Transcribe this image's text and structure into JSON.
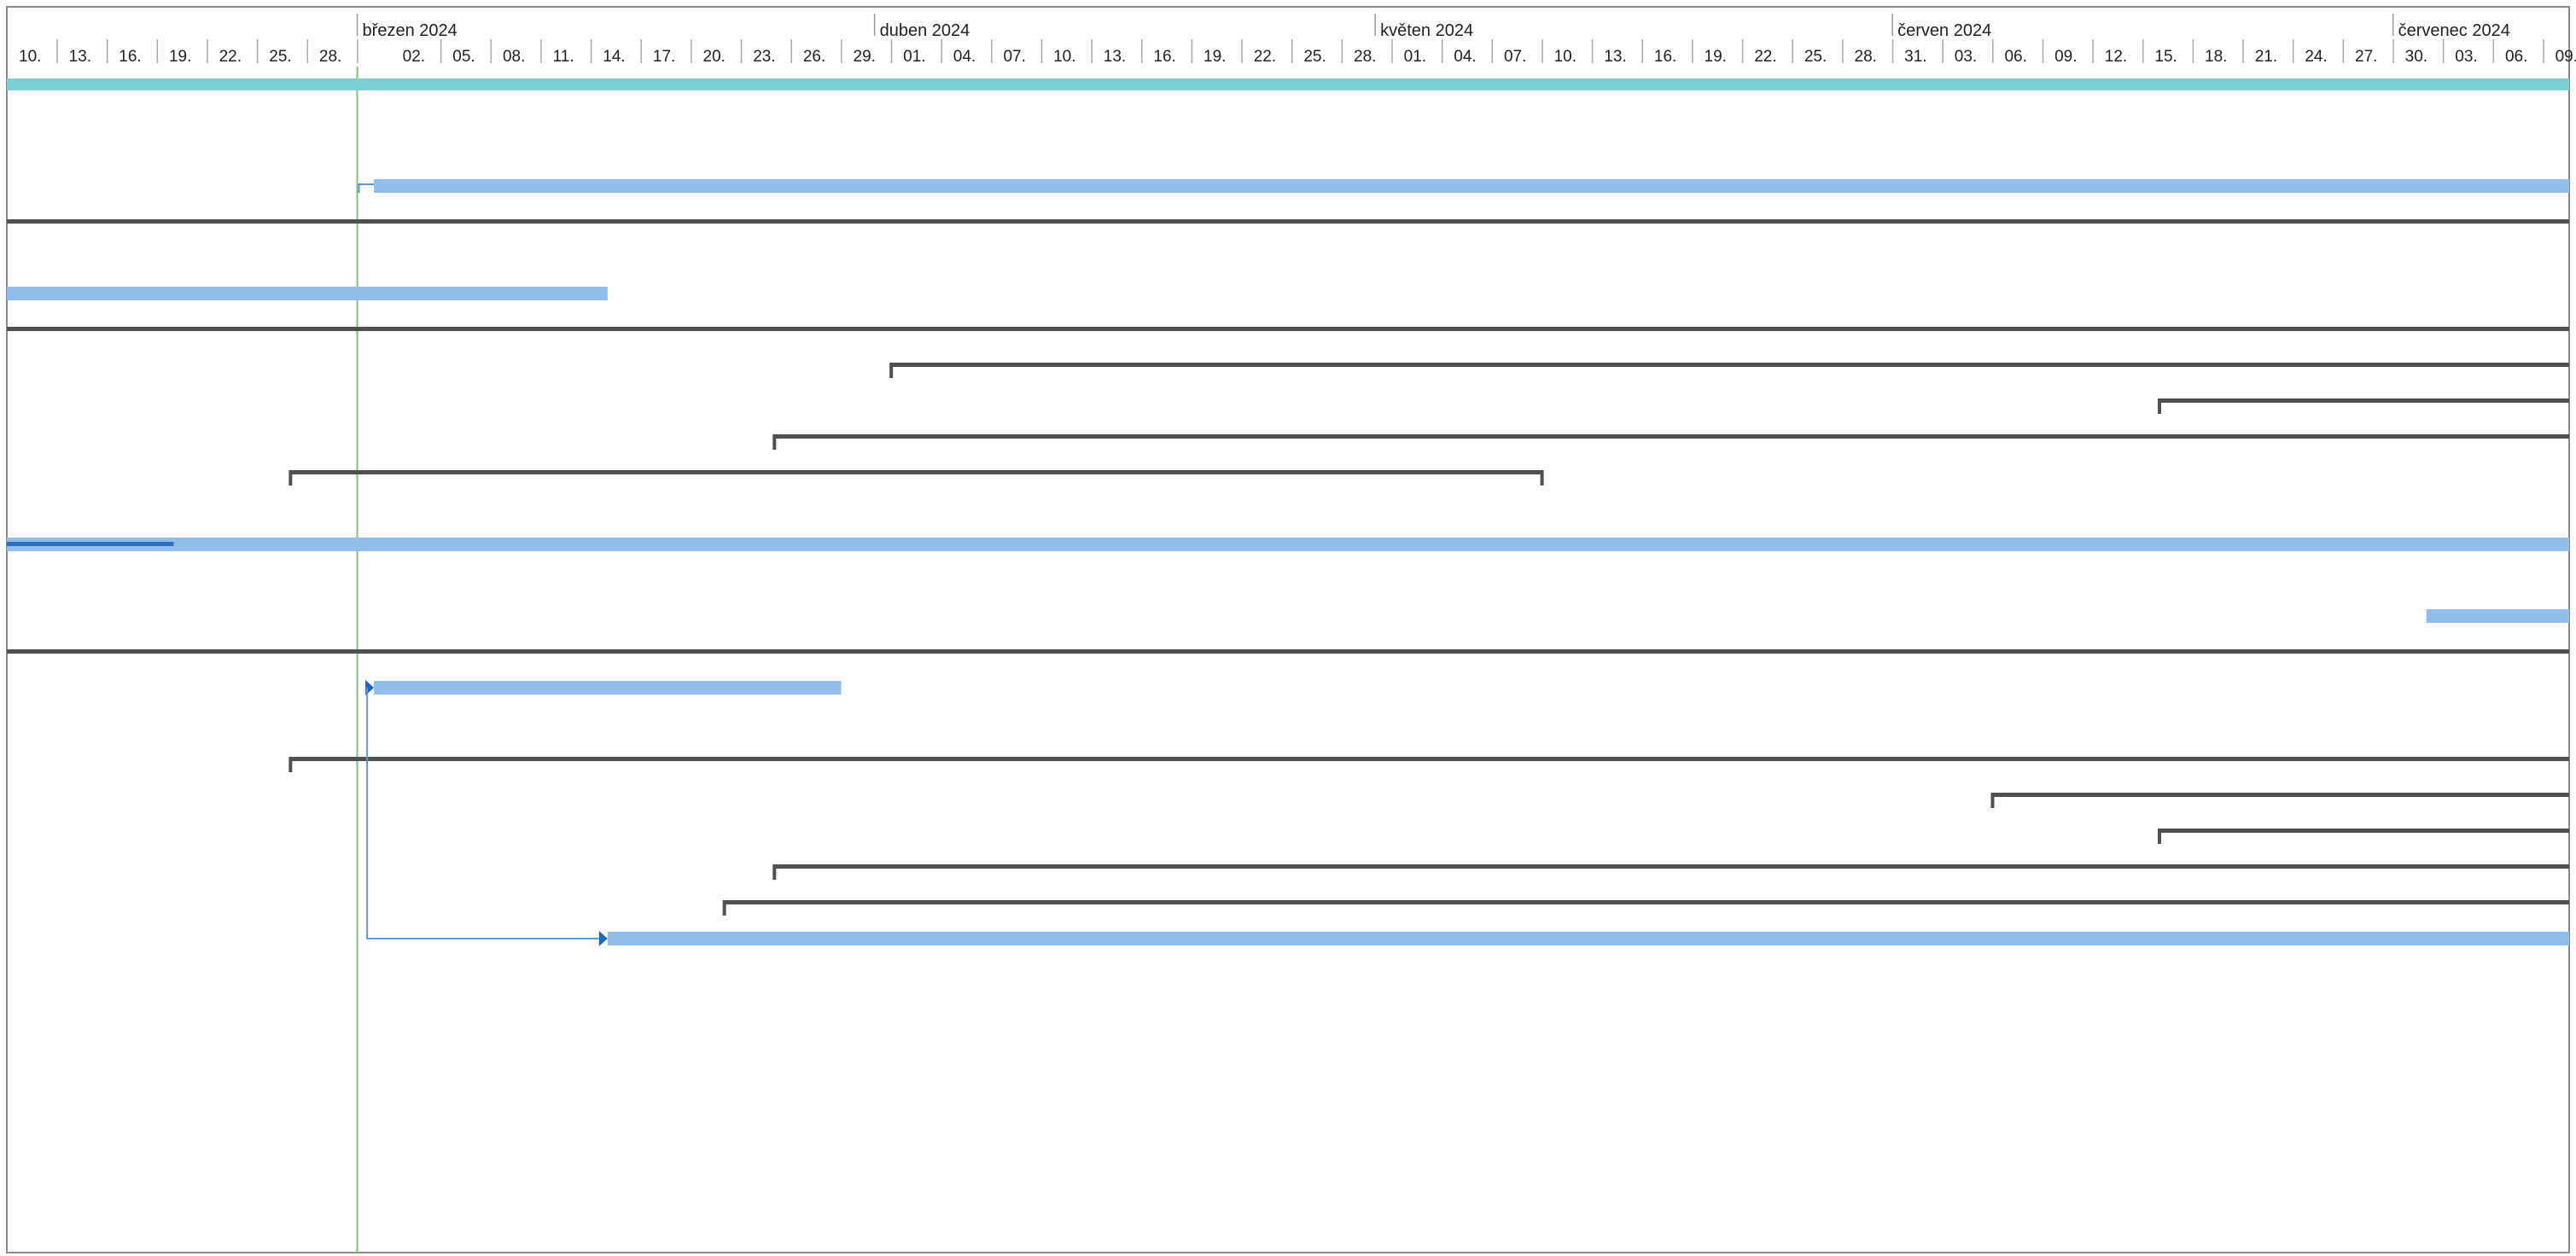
{
  "timescale": {
    "months": [
      "březen 2024",
      "duben 2024",
      "květen 2024",
      "červen 2024",
      "červenec 2024"
    ],
    "days": [
      "10.",
      "13.",
      "16.",
      "19.",
      "22.",
      "25.",
      "28.",
      "02.",
      "05.",
      "08.",
      "11.",
      "14.",
      "17.",
      "20.",
      "23.",
      "26.",
      "29.",
      "01.",
      "04.",
      "07.",
      "10.",
      "13.",
      "16.",
      "19.",
      "22.",
      "25.",
      "28.",
      "01.",
      "04.",
      "07.",
      "10.",
      "13.",
      "16.",
      "19.",
      "22.",
      "25.",
      "28.",
      "31.",
      "03.",
      "06.",
      "09.",
      "12.",
      "15.",
      "18.",
      "21.",
      "24.",
      "27.",
      "30.",
      "03.",
      "06.",
      "09."
    ]
  },
  "colors": {
    "summary_bar": "#7dcfd3",
    "task_bar": "#90bde9",
    "task_progress": "#2f6fbf",
    "range_line": "#505050",
    "today_line": "#7cc47c",
    "link": "#5a9ad6",
    "grid_text": "#222222",
    "border": "#8a8a8a"
  },
  "today_line": {
    "date": "2024-02-29"
  },
  "rows": [
    {
      "kind": "summary",
      "start": "2024-02-08",
      "end": "2024-07-13"
    },
    {
      "kind": "none"
    },
    {
      "kind": "none"
    },
    {
      "kind": "task",
      "start": "2024-03-01",
      "end": "2024-07-13",
      "has_predecessor_link": true
    },
    {
      "kind": "range_full",
      "start": "2024-02-08",
      "end": "2024-07-13"
    },
    {
      "kind": "none"
    },
    {
      "kind": "task",
      "start": "2024-02-08",
      "end": "2024-03-15"
    },
    {
      "kind": "range_full",
      "start": "2024-02-08",
      "end": "2024-07-13"
    },
    {
      "kind": "range",
      "start": "2024-04-01",
      "end": "2024-07-13",
      "left_tick": true
    },
    {
      "kind": "range",
      "start": "2024-06-16",
      "end": "2024-07-13",
      "left_tick": true
    },
    {
      "kind": "range",
      "start": "2024-03-25",
      "end": "2024-07-13",
      "left_tick": true
    },
    {
      "kind": "range",
      "start": "2024-02-25",
      "end": "2024-05-10",
      "left_tick": true,
      "right_tick": true
    },
    {
      "kind": "none"
    },
    {
      "kind": "task",
      "start": "2024-02-08",
      "end": "2024-07-13",
      "progress_end": "2024-02-18"
    },
    {
      "kind": "none"
    },
    {
      "kind": "task",
      "start": "2024-07-02",
      "end": "2024-07-13"
    },
    {
      "kind": "range_full",
      "start": "2024-02-08",
      "end": "2024-07-13"
    },
    {
      "kind": "task",
      "start": "2024-03-01",
      "end": "2024-03-29",
      "link_arrow": true
    },
    {
      "kind": "none"
    },
    {
      "kind": "range",
      "start": "2024-02-25",
      "end": "2024-07-13",
      "left_tick": true
    },
    {
      "kind": "range",
      "start": "2024-06-06",
      "end": "2024-07-13",
      "left_tick": true
    },
    {
      "kind": "range",
      "start": "2024-06-16",
      "end": "2024-07-13",
      "left_tick": true
    },
    {
      "kind": "range",
      "start": "2024-03-25",
      "end": "2024-07-13",
      "left_tick": true
    },
    {
      "kind": "range",
      "start": "2024-03-22",
      "end": "2024-07-13",
      "left_tick": true
    },
    {
      "kind": "task",
      "start": "2024-03-15",
      "end": "2024-07-13",
      "link_arrow": true
    }
  ]
}
